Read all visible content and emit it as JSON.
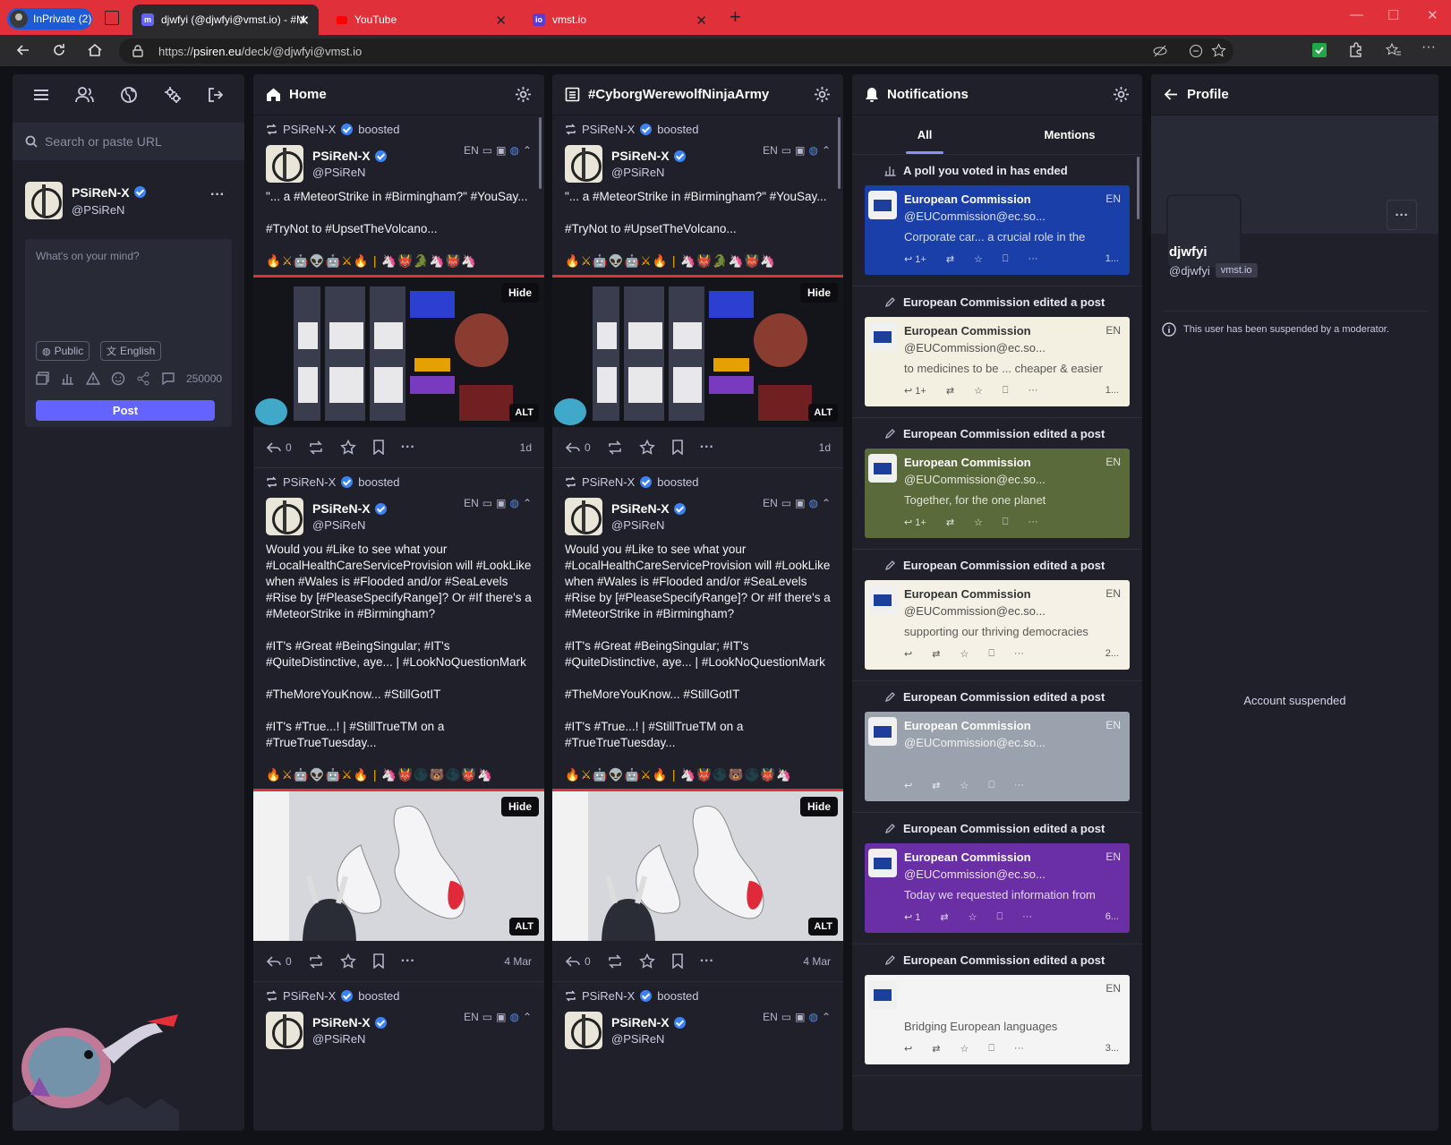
{
  "browser": {
    "inprivate_label": "InPrivate (2)",
    "tabs": [
      {
        "title": "djwfyi (@djwfyi@vmst.io) - #Mast",
        "active": true
      },
      {
        "title": "YouTube",
        "active": false
      },
      {
        "title": "vmst.io",
        "active": false
      }
    ],
    "url_prefix": "https://",
    "url_host": "psiren.eu",
    "url_path": "/deck/@djwfyi@vmst.io"
  },
  "sidebar": {
    "search_placeholder": "Search or paste URL",
    "account": {
      "name": "PSiReN-X",
      "handle": "@PSiReN"
    },
    "compose": {
      "placeholder": "What's on your mind?",
      "visibility": "Public",
      "language": "English",
      "char_count": "250000",
      "post_label": "Post"
    }
  },
  "columns": {
    "home": {
      "title": "Home"
    },
    "hashtag": {
      "title": "#CyborgWerewolfNinjaArmy"
    },
    "notifications": {
      "title": "Notifications",
      "tab_all": "All",
      "tab_mentions": "Mentions"
    },
    "profile": {
      "title": "Profile"
    }
  },
  "posts": [
    {
      "booster": "PSiReN-X",
      "boosted_label": "boosted",
      "name": "PSiReN-X",
      "handle": "@PSiReN",
      "lang": "EN",
      "paragraphs": [
        "\"... a #MeteorStrike in #Birmingham?\" #YouSay...",
        "#TryNot to #UpsetTheVolcano..."
      ],
      "emoji_line": "🔥⚔🤖👽🤖⚔🔥 | 🦄👹🐊🦄👹🦄",
      "replies": "0",
      "time": "1d",
      "hide_label": "Hide",
      "alt_label": "ALT"
    },
    {
      "booster": "PSiReN-X",
      "boosted_label": "boosted",
      "name": "PSiReN-X",
      "handle": "@PSiReN",
      "lang": "EN",
      "paragraphs": [
        "Would you #Like to see what your #LocalHealthCareServiceProvision will #LookLike when #Wales is #Flooded and/or #SeaLevels #Rise by [#PleaseSpecifyRange]? Or #If there's a #MeteorStrike in #Birmingham?",
        "#IT's #Great #BeingSingular; #IT's #QuiteDistinctive, aye... | #LookNoQuestionMark",
        "#TheMoreYouKnow... #StillGotIT",
        "#IT's #True...! | #StillTrueTM on a #TrueTrueTuesday..."
      ],
      "emoji_line": "🔥⚔🤖👽🤖⚔🔥 | 🦄👹🌑🐻🌑👹🦄",
      "replies": "0",
      "time": "4 Mar",
      "hide_label": "Hide",
      "alt_label": "ALT"
    },
    {
      "booster": "PSiReN-X",
      "boosted_label": "boosted",
      "name": "PSiReN-X",
      "handle": "@PSiReN",
      "lang": "EN"
    }
  ],
  "notifications": [
    {
      "header": "A poll you voted in has ended",
      "name": "European Commission",
      "handle": "@EUCommission@ec.so...",
      "text": "Corporate car... a crucial role in the",
      "bg": "#1a3fa8",
      "lang": "EN",
      "replies": "1+",
      "time": "1..."
    },
    {
      "header": "European Commission edited a post",
      "name": "European Commission",
      "handle": "@EUCommission@ec.so...",
      "text": "to medicines to be ... cheaper & easier",
      "bg": "#f3f0e2",
      "lang": "EN",
      "replies": "1+",
      "time": "1..."
    },
    {
      "header": "European Commission edited a post",
      "name": "European Commission",
      "handle": "@EUCommission@ec.so...",
      "text": "Together, for the one planet",
      "bg": "#5a6a3a",
      "lang": "EN",
      "replies": "1+",
      "time": ""
    },
    {
      "header": "European Commission edited a post",
      "name": "European Commission",
      "handle": "@EUCommission@ec.so...",
      "text": "supporting our thriving democracies",
      "bg": "#f5f1e6",
      "lang": "EN",
      "replies": "",
      "time": "2..."
    },
    {
      "header": "European Commission edited a post",
      "name": "European Commission",
      "handle": "@EUCommission@ec.so...",
      "text": "",
      "bg": "#9aa3ad",
      "lang": "EN",
      "replies": "",
      "time": ""
    },
    {
      "header": "European Commission edited a post",
      "name": "European Commission",
      "handle": "@EUCommission@ec.so...",
      "text": "Today we requested information from",
      "bg": "#6b2fa5",
      "lang": "EN",
      "replies": "1",
      "time": "6..."
    },
    {
      "header": "European Commission edited a post",
      "name": "",
      "handle": "",
      "text": "Bridging European languages",
      "bg": "#f4f4f4",
      "lang": "EN",
      "replies": "",
      "time": "3..."
    }
  ],
  "profile": {
    "name": "djwfyi",
    "handle": "@djwfyi",
    "instance": "vmst.io",
    "suspended_notice": "This user has been suspended by a moderator.",
    "account_suspended": "Account suspended"
  }
}
